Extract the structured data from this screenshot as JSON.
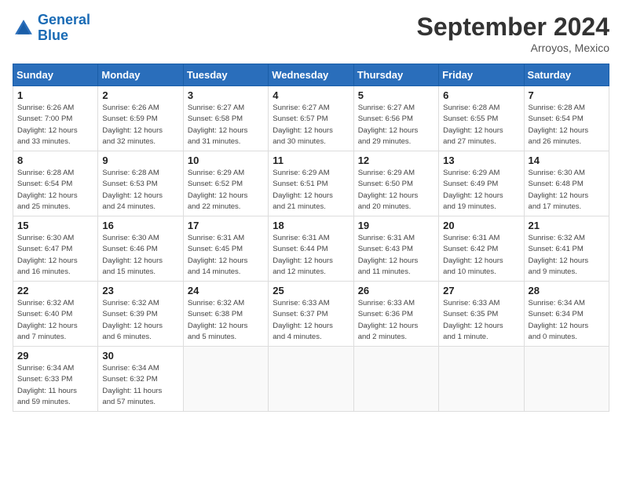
{
  "logo": {
    "line1": "General",
    "line2": "Blue"
  },
  "title": "September 2024",
  "location": "Arroyos, Mexico",
  "days_of_week": [
    "Sunday",
    "Monday",
    "Tuesday",
    "Wednesday",
    "Thursday",
    "Friday",
    "Saturday"
  ],
  "weeks": [
    [
      {
        "day": 1,
        "sunrise": "6:26 AM",
        "sunset": "7:00 PM",
        "daylight": "12 hours and 33 minutes."
      },
      {
        "day": 2,
        "sunrise": "6:26 AM",
        "sunset": "6:59 PM",
        "daylight": "12 hours and 32 minutes."
      },
      {
        "day": 3,
        "sunrise": "6:27 AM",
        "sunset": "6:58 PM",
        "daylight": "12 hours and 31 minutes."
      },
      {
        "day": 4,
        "sunrise": "6:27 AM",
        "sunset": "6:57 PM",
        "daylight": "12 hours and 30 minutes."
      },
      {
        "day": 5,
        "sunrise": "6:27 AM",
        "sunset": "6:56 PM",
        "daylight": "12 hours and 29 minutes."
      },
      {
        "day": 6,
        "sunrise": "6:28 AM",
        "sunset": "6:55 PM",
        "daylight": "12 hours and 27 minutes."
      },
      {
        "day": 7,
        "sunrise": "6:28 AM",
        "sunset": "6:54 PM",
        "daylight": "12 hours and 26 minutes."
      }
    ],
    [
      {
        "day": 8,
        "sunrise": "6:28 AM",
        "sunset": "6:54 PM",
        "daylight": "12 hours and 25 minutes."
      },
      {
        "day": 9,
        "sunrise": "6:28 AM",
        "sunset": "6:53 PM",
        "daylight": "12 hours and 24 minutes."
      },
      {
        "day": 10,
        "sunrise": "6:29 AM",
        "sunset": "6:52 PM",
        "daylight": "12 hours and 22 minutes."
      },
      {
        "day": 11,
        "sunrise": "6:29 AM",
        "sunset": "6:51 PM",
        "daylight": "12 hours and 21 minutes."
      },
      {
        "day": 12,
        "sunrise": "6:29 AM",
        "sunset": "6:50 PM",
        "daylight": "12 hours and 20 minutes."
      },
      {
        "day": 13,
        "sunrise": "6:29 AM",
        "sunset": "6:49 PM",
        "daylight": "12 hours and 19 minutes."
      },
      {
        "day": 14,
        "sunrise": "6:30 AM",
        "sunset": "6:48 PM",
        "daylight": "12 hours and 17 minutes."
      }
    ],
    [
      {
        "day": 15,
        "sunrise": "6:30 AM",
        "sunset": "6:47 PM",
        "daylight": "12 hours and 16 minutes."
      },
      {
        "day": 16,
        "sunrise": "6:30 AM",
        "sunset": "6:46 PM",
        "daylight": "12 hours and 15 minutes."
      },
      {
        "day": 17,
        "sunrise": "6:31 AM",
        "sunset": "6:45 PM",
        "daylight": "12 hours and 14 minutes."
      },
      {
        "day": 18,
        "sunrise": "6:31 AM",
        "sunset": "6:44 PM",
        "daylight": "12 hours and 12 minutes."
      },
      {
        "day": 19,
        "sunrise": "6:31 AM",
        "sunset": "6:43 PM",
        "daylight": "12 hours and 11 minutes."
      },
      {
        "day": 20,
        "sunrise": "6:31 AM",
        "sunset": "6:42 PM",
        "daylight": "12 hours and 10 minutes."
      },
      {
        "day": 21,
        "sunrise": "6:32 AM",
        "sunset": "6:41 PM",
        "daylight": "12 hours and 9 minutes."
      }
    ],
    [
      {
        "day": 22,
        "sunrise": "6:32 AM",
        "sunset": "6:40 PM",
        "daylight": "12 hours and 7 minutes."
      },
      {
        "day": 23,
        "sunrise": "6:32 AM",
        "sunset": "6:39 PM",
        "daylight": "12 hours and 6 minutes."
      },
      {
        "day": 24,
        "sunrise": "6:32 AM",
        "sunset": "6:38 PM",
        "daylight": "12 hours and 5 minutes."
      },
      {
        "day": 25,
        "sunrise": "6:33 AM",
        "sunset": "6:37 PM",
        "daylight": "12 hours and 4 minutes."
      },
      {
        "day": 26,
        "sunrise": "6:33 AM",
        "sunset": "6:36 PM",
        "daylight": "12 hours and 2 minutes."
      },
      {
        "day": 27,
        "sunrise": "6:33 AM",
        "sunset": "6:35 PM",
        "daylight": "12 hours and 1 minute."
      },
      {
        "day": 28,
        "sunrise": "6:34 AM",
        "sunset": "6:34 PM",
        "daylight": "12 hours and 0 minutes."
      }
    ],
    [
      {
        "day": 29,
        "sunrise": "6:34 AM",
        "sunset": "6:33 PM",
        "daylight": "11 hours and 59 minutes."
      },
      {
        "day": 30,
        "sunrise": "6:34 AM",
        "sunset": "6:32 PM",
        "daylight": "11 hours and 57 minutes."
      },
      null,
      null,
      null,
      null,
      null
    ]
  ]
}
